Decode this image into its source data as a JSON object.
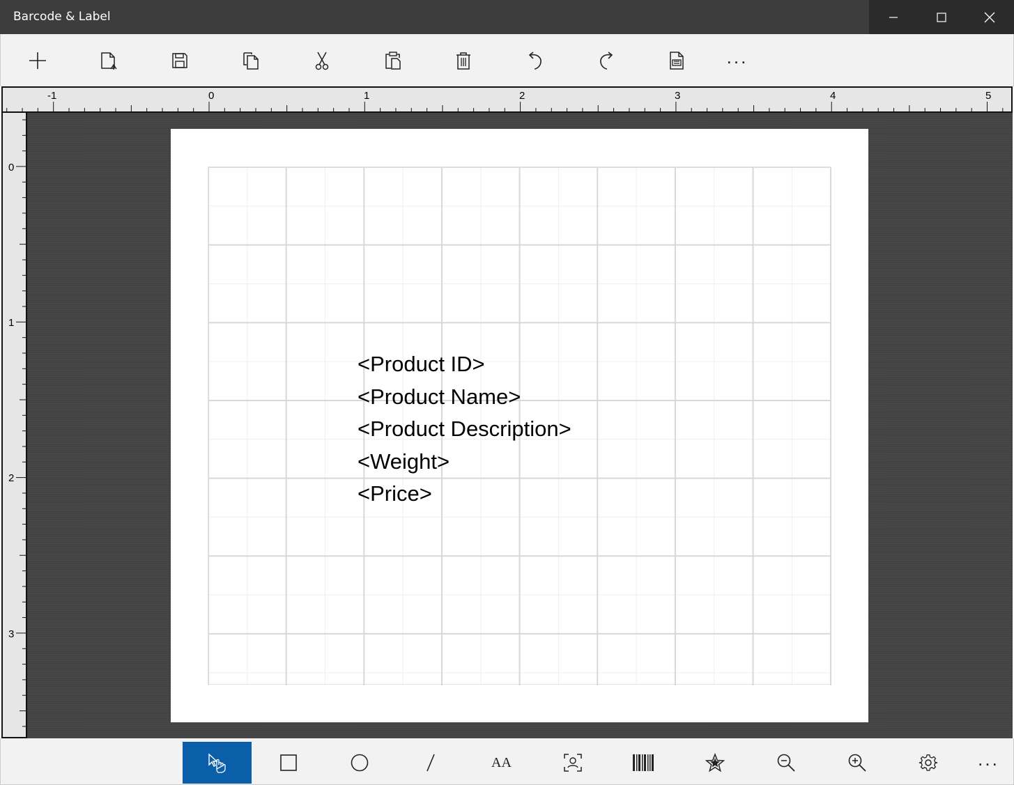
{
  "window": {
    "title": "Barcode & Label",
    "controls": [
      "minimize",
      "maximize",
      "close"
    ]
  },
  "toolbar": {
    "items": [
      {
        "name": "new-button",
        "icon": "plus-icon"
      },
      {
        "name": "open-button",
        "icon": "open-file-icon"
      },
      {
        "name": "save-button",
        "icon": "save-icon"
      },
      {
        "name": "copy-button",
        "icon": "copy-icon"
      },
      {
        "name": "cut-button",
        "icon": "scissors-icon"
      },
      {
        "name": "paste-button",
        "icon": "clipboard-icon"
      },
      {
        "name": "delete-button",
        "icon": "trash-icon"
      },
      {
        "name": "undo-button",
        "icon": "undo-icon"
      },
      {
        "name": "redo-button",
        "icon": "redo-icon"
      },
      {
        "name": "print-button",
        "icon": "print-document-icon"
      },
      {
        "name": "more-button",
        "icon": "more-icon"
      }
    ],
    "more_label": "..."
  },
  "rulers": {
    "horizontal_labels": [
      "-1",
      "0",
      "1",
      "2",
      "3",
      "4",
      "5"
    ],
    "vertical_labels": [
      "0",
      "1",
      "2",
      "3"
    ]
  },
  "label_fields": [
    "<Product ID>",
    "<Product Name>",
    "<Product Description>",
    "<Weight>",
    "<Price>"
  ],
  "bottom_toolbar": {
    "items": [
      {
        "name": "select-tool",
        "icon": "pointer-hand-icon",
        "active": true
      },
      {
        "name": "rectangle-tool",
        "icon": "rectangle-icon",
        "active": false
      },
      {
        "name": "ellipse-tool",
        "icon": "circle-icon",
        "active": false
      },
      {
        "name": "line-tool",
        "icon": "line-icon",
        "active": false
      },
      {
        "name": "text-tool",
        "icon": "text-size-icon",
        "active": false
      },
      {
        "name": "image-tool",
        "icon": "image-scan-icon",
        "active": false
      },
      {
        "name": "barcode-tool",
        "icon": "barcode-icon",
        "active": false
      },
      {
        "name": "shape-tool",
        "icon": "star-icon",
        "active": false
      },
      {
        "name": "zoom-out-button",
        "icon": "zoom-out-icon",
        "active": false
      },
      {
        "name": "zoom-in-button",
        "icon": "zoom-in-icon",
        "active": false
      },
      {
        "name": "settings-button",
        "icon": "gear-icon",
        "active": false
      },
      {
        "name": "more-button",
        "icon": "more-icon",
        "active": false
      }
    ],
    "more_label": "...",
    "text_tool_glyph": "AA"
  },
  "colors": {
    "titlebar": "#3d3d3d",
    "accent": "#0b5ea8",
    "canvas": "#454545"
  }
}
